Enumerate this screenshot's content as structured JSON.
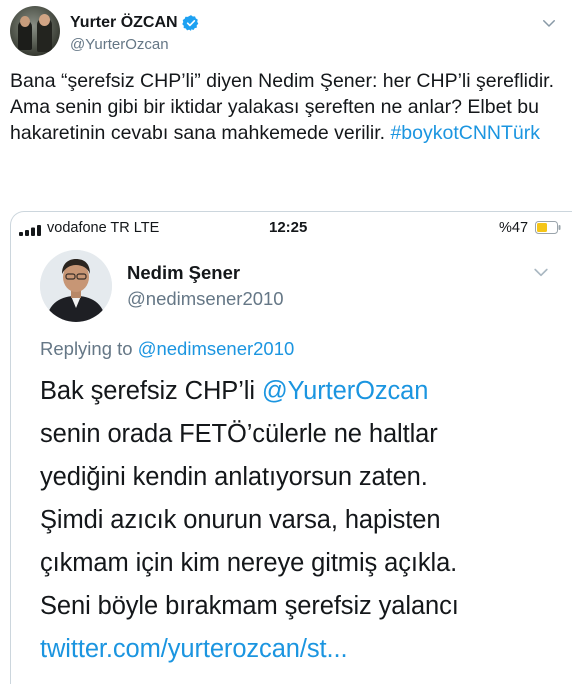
{
  "tweet": {
    "author_name": "Yurter ÖZCAN",
    "author_handle": "@YurterOzcan",
    "text_main": "Bana “şerefsiz CHP’li” diyen Nedim Şener: her CHP’li şereflidir. Ama senin gibi bir iktidar yalakası şereften ne anlar? Elbet bu hakaretinin cevabı sana mahkemede verilir. ",
    "hashtag": "#boykotCNNTürk"
  },
  "screenshot": {
    "status_bar": {
      "carrier": "vodafone TR  LTE",
      "time": "12:25",
      "battery": "%47"
    },
    "quoted": {
      "author_name": "Nedim Şener",
      "author_handle": "@nedimsener2010",
      "replying_label": "Replying to ",
      "replying_to": "@nedimsener2010",
      "line1_prefix": "Bak şerefsiz CHP’li ",
      "line1_mention": "@YurterOzcan",
      "line2": "senin orada FETÖ’cülerle ne haltlar",
      "line3": "yediğini kendin anlatıyorsun zaten.",
      "line4": "Şimdi azıcık onurun varsa, hapisten",
      "line5": "çıkmam için kim nereye gitmiş açıkla.",
      "line6": "Seni böyle bırakmam  şerefsiz yalancı",
      "link": "twitter.com/yurterozcan/st..."
    }
  },
  "colors": {
    "link_blue": "#1b95e0",
    "verified_blue": "#1da1f2",
    "muted": "#657786",
    "battery_yellow": "#f5c518"
  },
  "icons": [
    "verified-badge-icon",
    "chevron-down-icon",
    "signal-bars-icon",
    "battery-icon"
  ]
}
